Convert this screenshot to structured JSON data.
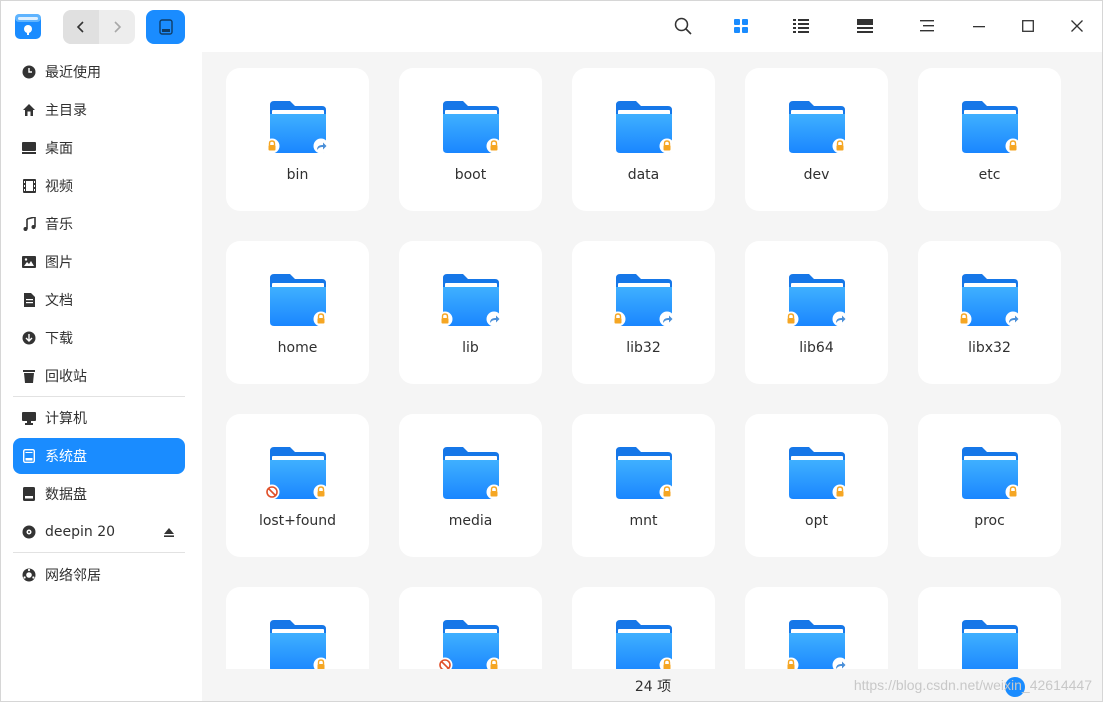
{
  "sidebar": {
    "items": [
      {
        "label": "最近使用",
        "icon": "clock-icon"
      },
      {
        "label": "主目录",
        "icon": "home-icon"
      },
      {
        "label": "桌面",
        "icon": "desktop-icon"
      },
      {
        "label": "视频",
        "icon": "video-icon"
      },
      {
        "label": "音乐",
        "icon": "music-icon"
      },
      {
        "label": "图片",
        "icon": "picture-icon"
      },
      {
        "label": "文档",
        "icon": "document-icon"
      },
      {
        "label": "下载",
        "icon": "download-icon"
      },
      {
        "label": "回收站",
        "icon": "trash-icon"
      }
    ],
    "devices": [
      {
        "label": "计算机",
        "icon": "computer-icon"
      },
      {
        "label": "系统盘",
        "icon": "system-disk-icon",
        "active": true
      },
      {
        "label": "数据盘",
        "icon": "data-disk-icon"
      },
      {
        "label": "deepin 20",
        "icon": "optical-disc-icon"
      }
    ],
    "network": [
      {
        "label": "网络邻居",
        "icon": "network-icon"
      }
    ]
  },
  "folders": [
    {
      "name": "bin",
      "lock": true,
      "link": true,
      "noaccess": false
    },
    {
      "name": "boot",
      "lock": true,
      "link": false,
      "noaccess": false
    },
    {
      "name": "data",
      "lock": true,
      "link": false,
      "noaccess": false
    },
    {
      "name": "dev",
      "lock": true,
      "link": false,
      "noaccess": false
    },
    {
      "name": "etc",
      "lock": true,
      "link": false,
      "noaccess": false
    },
    {
      "name": "home",
      "lock": true,
      "link": false,
      "noaccess": false
    },
    {
      "name": "lib",
      "lock": true,
      "link": true,
      "noaccess": false
    },
    {
      "name": "lib32",
      "lock": true,
      "link": true,
      "noaccess": false
    },
    {
      "name": "lib64",
      "lock": true,
      "link": true,
      "noaccess": false
    },
    {
      "name": "libx32",
      "lock": true,
      "link": true,
      "noaccess": false
    },
    {
      "name": "lost+found",
      "lock": true,
      "link": false,
      "noaccess": true
    },
    {
      "name": "media",
      "lock": true,
      "link": false,
      "noaccess": false
    },
    {
      "name": "mnt",
      "lock": true,
      "link": false,
      "noaccess": false
    },
    {
      "name": "opt",
      "lock": true,
      "link": false,
      "noaccess": false
    },
    {
      "name": "proc",
      "lock": true,
      "link": false,
      "noaccess": false
    },
    {
      "name": "",
      "lock": true,
      "link": false,
      "noaccess": false
    },
    {
      "name": "",
      "lock": true,
      "link": false,
      "noaccess": true
    },
    {
      "name": "",
      "lock": true,
      "link": false,
      "noaccess": false
    },
    {
      "name": "",
      "lock": true,
      "link": true,
      "noaccess": false
    },
    {
      "name": "",
      "lock": false,
      "link": false,
      "noaccess": false
    }
  ],
  "status": {
    "count": "24 项"
  },
  "watermark": "https://blog.csdn.net/weixin_42614447",
  "colors": {
    "accent": "#1a8cff",
    "folder": "#2a9cff",
    "lock": "#f5a623",
    "noaccess": "#e0502a"
  }
}
